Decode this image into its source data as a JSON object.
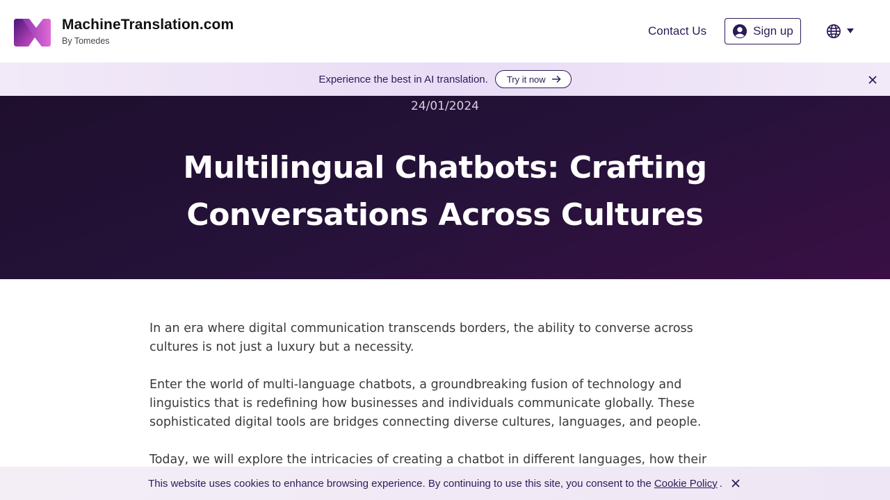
{
  "header": {
    "logo_title": "MachineTranslation.com",
    "logo_subtitle": "By Tomedes",
    "contact_label": "Contact Us",
    "signup_label": "Sign up",
    "icons": {
      "account": "user-circle-icon",
      "language": "globe-icon",
      "dropdown": "caret-down-icon"
    }
  },
  "promo": {
    "text": "Experience the best in AI translation.",
    "button_label": "Try it now",
    "icons": {
      "button": "arrow-right-icon",
      "close": "close-icon"
    }
  },
  "hero": {
    "date": "24/01/2024",
    "title": "Multilingual Chatbots: Crafting Conversations Across Cultures"
  },
  "article": {
    "paragraphs": [
      "In an era where digital communication transcends borders, the ability to converse across cultures is not just a luxury but a necessity.",
      "Enter the world of multi-language chatbots, a groundbreaking fusion of technology and linguistics that is redefining how businesses and individuals communicate globally. These sophisticated digital tools are bridges connecting diverse cultures, languages, and people.",
      "Today, we will explore the intricacies of creating a chatbot in different languages, how their"
    ]
  },
  "cookie": {
    "text": "This website uses cookies to enhance browsing experience. By continuing to use this site, you consent to the",
    "link_label": "Cookie Policy",
    "suffix": "."
  },
  "colors": {
    "brand_dark": "#2d1a57",
    "hero_bg": "#26123a",
    "logo_gradient_start": "#5a1a8a",
    "logo_gradient_end": "#d34fc8"
  }
}
